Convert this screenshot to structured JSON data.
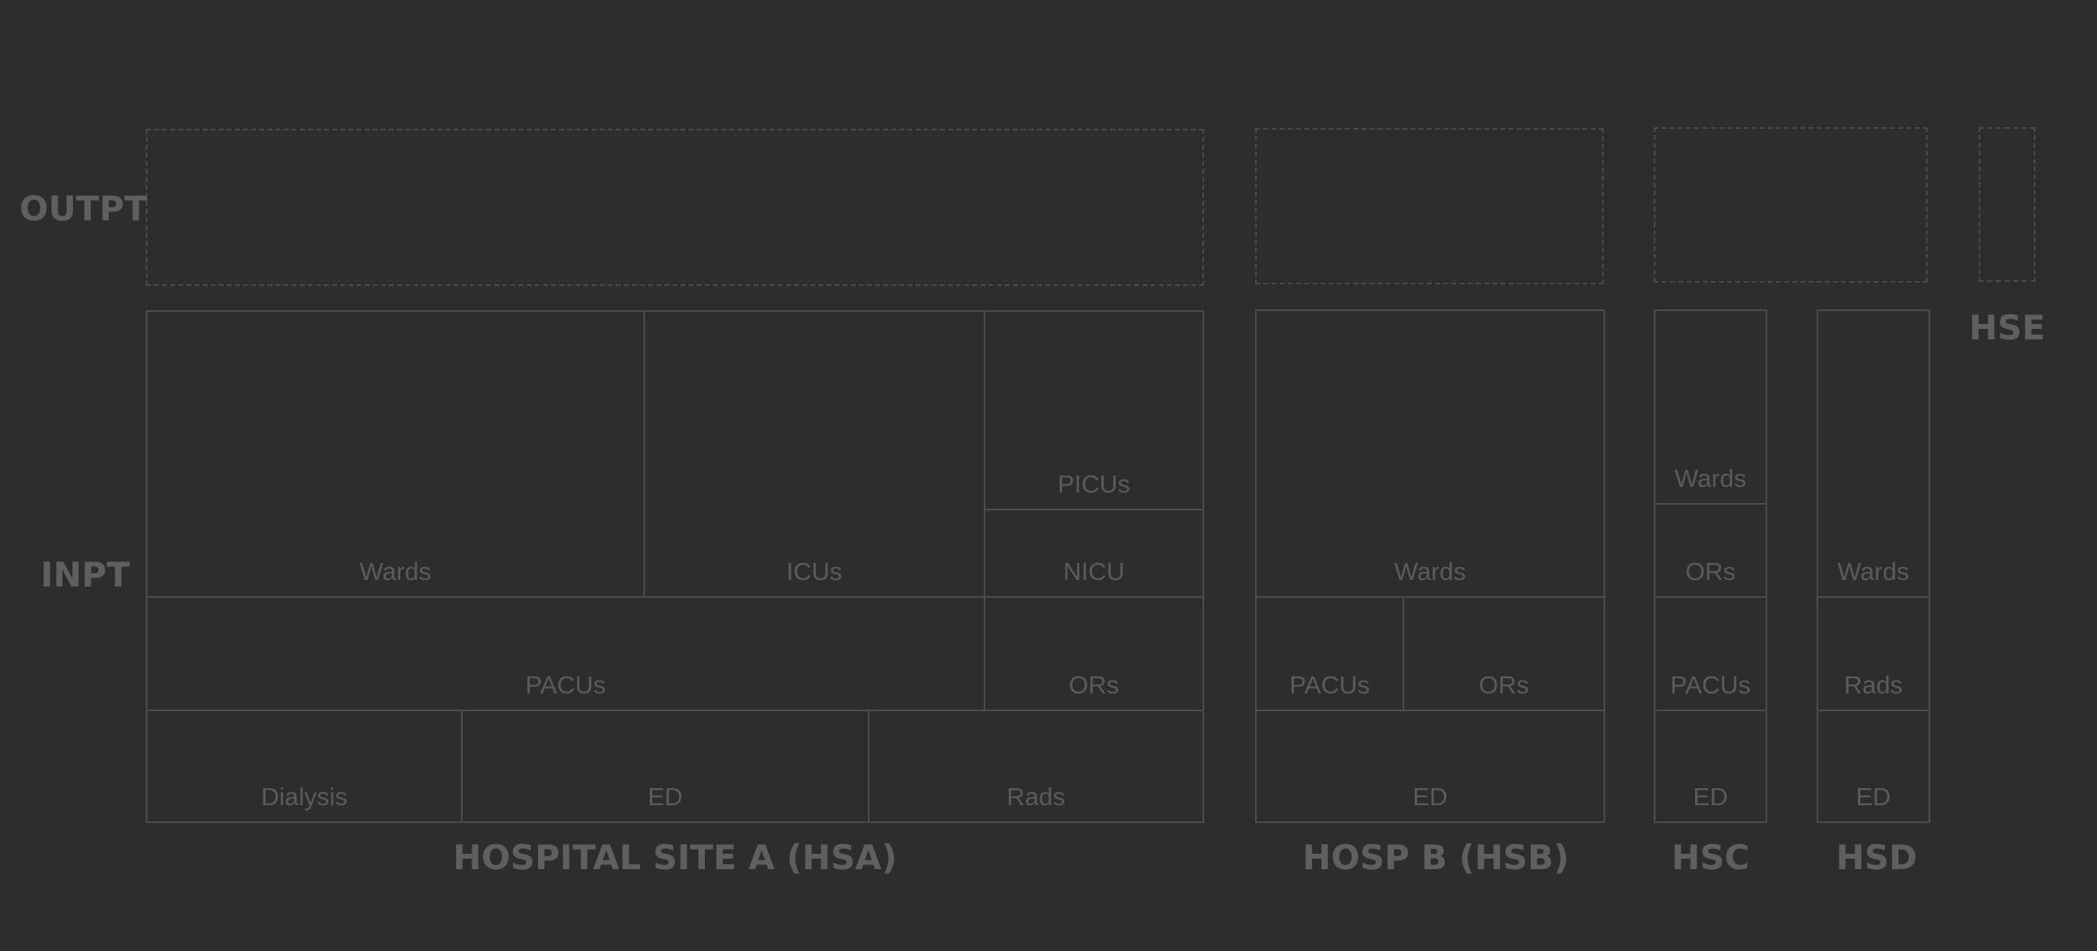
{
  "colors": {
    "background": "#2d2d2d",
    "line": "#4c4c4c",
    "dashed_line": "#4a4a4a",
    "label_text": "#5b5b5b",
    "heading_text": "#5f5f5f"
  },
  "row_labels": {
    "outpatient": "OUTPT",
    "inpatient": "INPT"
  },
  "sites": {
    "hsa": {
      "label": "HOSPITAL SITE A (HSA)",
      "units": {
        "wards": "Wards",
        "icus": "ICUs",
        "picus": "PICUs",
        "nicu": "NICU",
        "pacus": "PACUs",
        "ors": "ORs",
        "dialysis": "Dialysis",
        "ed": "ED",
        "rads": "Rads"
      }
    },
    "hsb": {
      "label": "HOSP B (HSB)",
      "units": {
        "wards": "Wards",
        "pacus": "PACUs",
        "ors": "ORs",
        "ed": "ED"
      }
    },
    "hsc": {
      "label": "HSC",
      "units": {
        "wards": "Wards",
        "ors": "ORs",
        "pacus": "PACUs",
        "ed": "ED"
      }
    },
    "hsd": {
      "label": "HSD",
      "units": {
        "wards": "Wards",
        "rads": "Rads",
        "ed": "ED"
      }
    },
    "hse": {
      "label": "HSE"
    }
  }
}
